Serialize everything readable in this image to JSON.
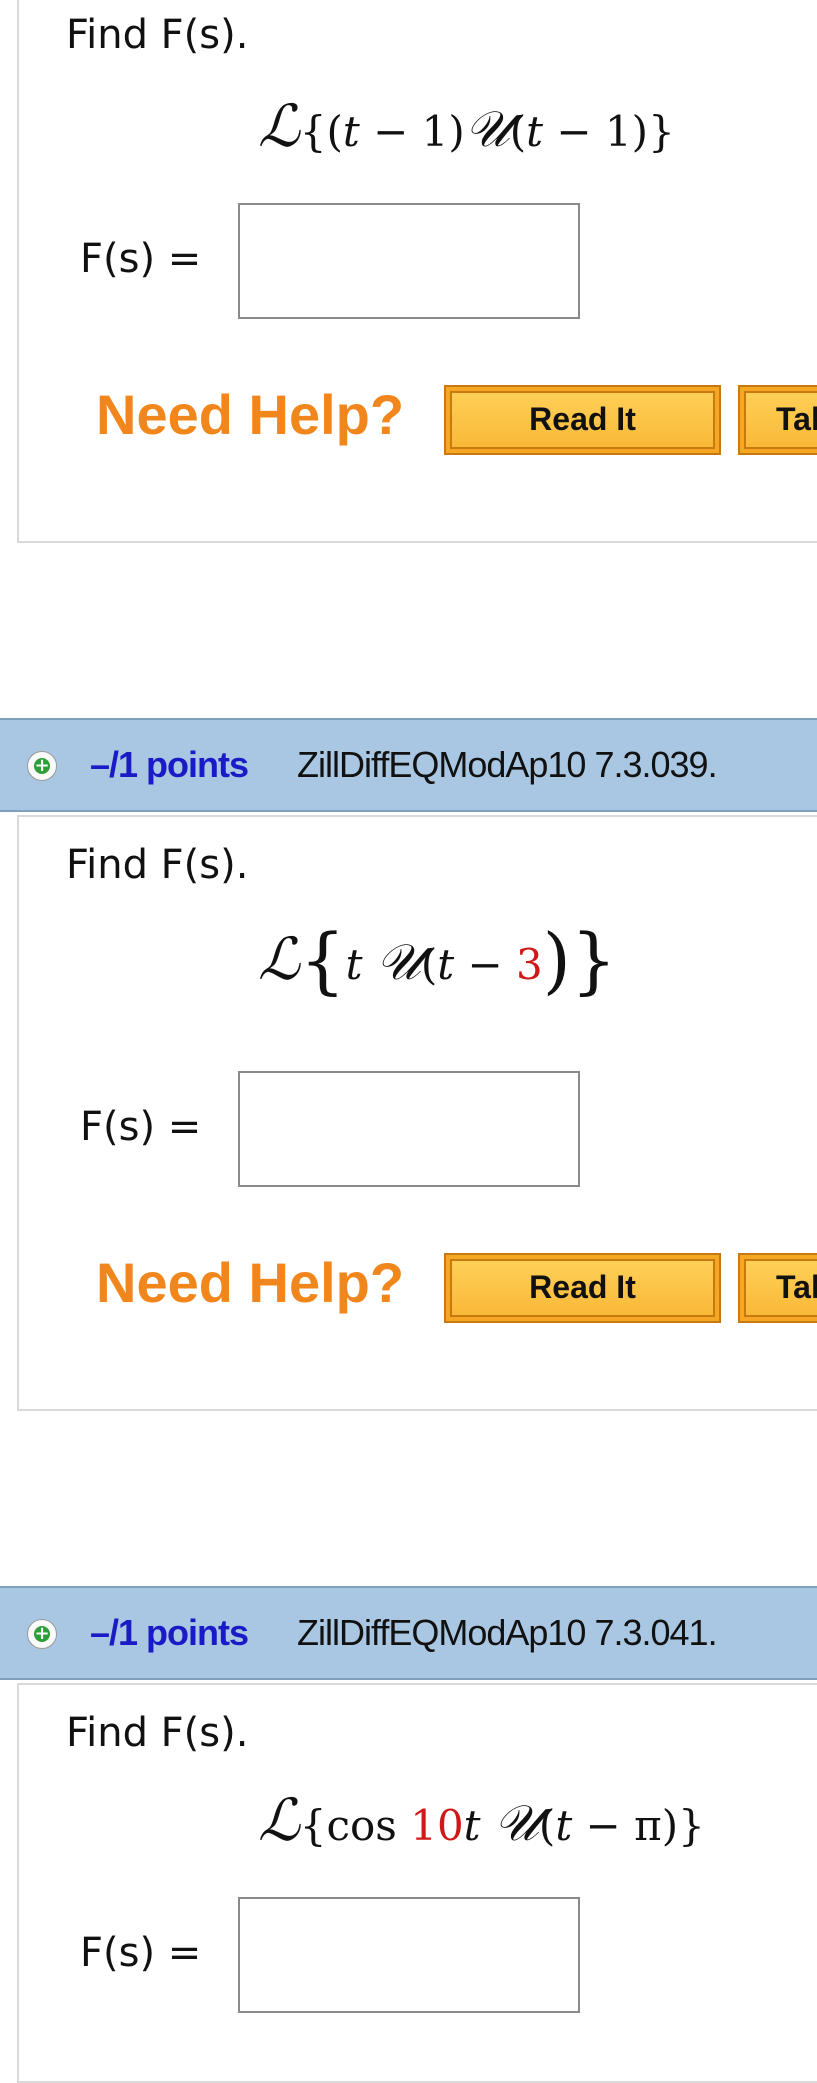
{
  "questions": [
    {
      "prompt": "Find F(s).",
      "expression": {
        "operator": "ℒ",
        "open": "{(",
        "var1": "t",
        "part2": " − 1)",
        "step": "𝒰",
        "part3": "(",
        "var2": "t",
        "part4": " − 1)}"
      },
      "answer_label": "F(s) =",
      "answer_value": "",
      "help_label": "Need Help?",
      "buttons": [
        "Read It",
        "Talk to a Tutor"
      ]
    },
    {
      "points": "–/1 points",
      "id": "ZillDiffEQModAp10 7.3.039.",
      "prompt": "Find F(s).",
      "expression": {
        "operator": "ℒ",
        "open": "{",
        "var1": "t",
        "step": "𝒰",
        "part3": "(",
        "var2": "t",
        "part4": " − ",
        "red": "3",
        "close": ")}"
      },
      "answer_label": "F(s) =",
      "answer_value": "",
      "help_label": "Need Help?",
      "buttons": [
        "Read It",
        "Talk to a Tutor"
      ]
    },
    {
      "points": "–/1 points",
      "id": "ZillDiffEQModAp10 7.3.041.",
      "prompt": "Find F(s).",
      "expression": {
        "operator": "ℒ",
        "open": "{cos ",
        "red": "10",
        "var1": "t",
        "step": "𝒰",
        "part3": "(",
        "var2": "t",
        "part4": " − π)}"
      },
      "answer_label": "F(s) =",
      "answer_value": ""
    }
  ],
  "icons": {
    "expand": "plus-circle-icon"
  },
  "colors": {
    "header_bg": "#a9c7e2",
    "points_text": "#1a1ac7",
    "need_help": "#f0861c",
    "button": "#f9b938",
    "highlight": "#d01818"
  }
}
